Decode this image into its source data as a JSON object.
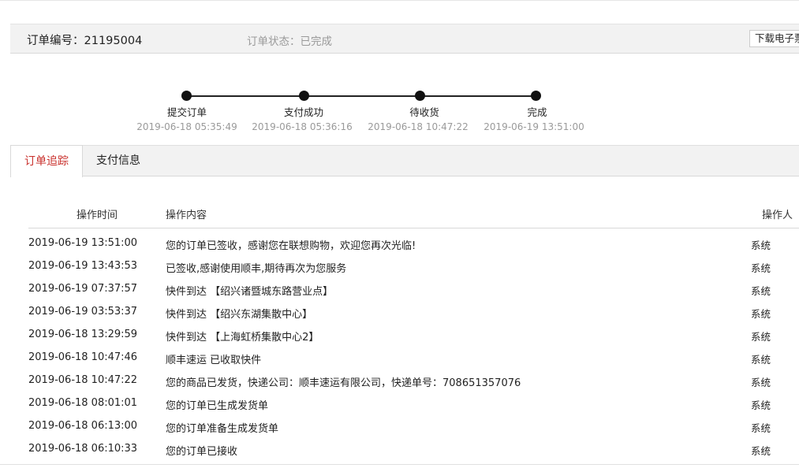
{
  "order": {
    "number_text": "订单编号：21195004",
    "status_text": "订单状态：已完成",
    "download_label": "下载电子票"
  },
  "progress": {
    "steps": [
      {
        "label": "提交订单",
        "time": "2019-06-18 05:35:49"
      },
      {
        "label": "支付成功",
        "time": "2019-06-18 05:36:16"
      },
      {
        "label": "待收货",
        "time": "2019-06-18 10:47:22"
      },
      {
        "label": "完成",
        "time": "2019-06-19 13:51:00"
      }
    ]
  },
  "tabs": [
    {
      "label": "订单追踪",
      "active": true
    },
    {
      "label": "支付信息",
      "active": false
    }
  ],
  "table": {
    "headers": {
      "time": "操作时间",
      "content": "操作内容",
      "operator": "操作人"
    },
    "rows": [
      {
        "time": "2019-06-19 13:51:00",
        "content": "您的订单已签收，感谢您在联想购物，欢迎您再次光临!",
        "operator": "系统"
      },
      {
        "time": "2019-06-19 13:43:53",
        "content": "已签收,感谢使用顺丰,期待再次为您服务",
        "operator": "系统"
      },
      {
        "time": "2019-06-19 07:37:57",
        "content": "快件到达 【绍兴诸暨城东路营业点】",
        "operator": "系统"
      },
      {
        "time": "2019-06-19 03:53:37",
        "content": "快件到达 【绍兴东湖集散中心】",
        "operator": "系统"
      },
      {
        "time": "2019-06-18 13:29:59",
        "content": "快件到达 【上海虹桥集散中心2】",
        "operator": "系统"
      },
      {
        "time": "2019-06-18 10:47:46",
        "content": "顺丰速运 已收取快件",
        "operator": "系统"
      },
      {
        "time": "2019-06-18 10:47:22",
        "content": "您的商品已发货，快递公司：顺丰速运有限公司，快递单号：708651357076",
        "operator": "系统"
      },
      {
        "time": "2019-06-18 08:01:01",
        "content": "您的订单已生成发货单",
        "operator": "系统"
      },
      {
        "time": "2019-06-18 06:13:00",
        "content": "您的订单准备生成发货单",
        "operator": "系统"
      },
      {
        "time": "2019-06-18 06:10:33",
        "content": "您的订单已接收",
        "operator": "系统"
      }
    ]
  },
  "colors": {
    "active_tab": "#c9302c",
    "header_bg": "#f2f2f2",
    "muted_text": "#999999"
  }
}
